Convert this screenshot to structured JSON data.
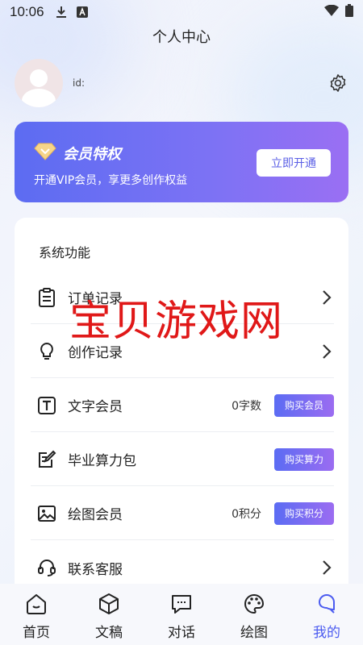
{
  "status_bar": {
    "time": "10:06",
    "icons": [
      "download-icon",
      "a-badge-icon",
      "wifi-icon",
      "battery-icon"
    ]
  },
  "header": {
    "title": "个人中心"
  },
  "profile": {
    "id_label": "id:"
  },
  "vip": {
    "title": "会员特权",
    "subtitle": "开通VIP会员，享更多创作权益",
    "button": "立即开通",
    "colors": {
      "start": "#5c6cf2",
      "end": "#9a6ff3"
    }
  },
  "system": {
    "title": "系统功能",
    "items": [
      {
        "label": "订单记录",
        "icon": "clipboard-icon"
      },
      {
        "label": "创作记录",
        "icon": "lightbulb-icon"
      },
      {
        "label": "文字会员",
        "icon": "text-t-icon",
        "value": "0字数",
        "button": "购买会员"
      },
      {
        "label": "毕业算力包",
        "icon": "edit-note-icon",
        "button": "购买算力"
      },
      {
        "label": "绘图会员",
        "icon": "image-icon",
        "value": "0积分",
        "button": "购买积分"
      },
      {
        "label": "联系客服",
        "icon": "headset-icon"
      }
    ]
  },
  "watermark": "宝贝游戏网",
  "tabbar": {
    "tabs": [
      {
        "label": "首页",
        "icon": "home-icon"
      },
      {
        "label": "文稿",
        "icon": "cube-icon"
      },
      {
        "label": "对话",
        "icon": "chat-icon"
      },
      {
        "label": "绘图",
        "icon": "palette-icon"
      },
      {
        "label": "我的",
        "icon": "profile-leaf-icon",
        "active": true
      }
    ],
    "active_color": "#4c5cf0"
  }
}
